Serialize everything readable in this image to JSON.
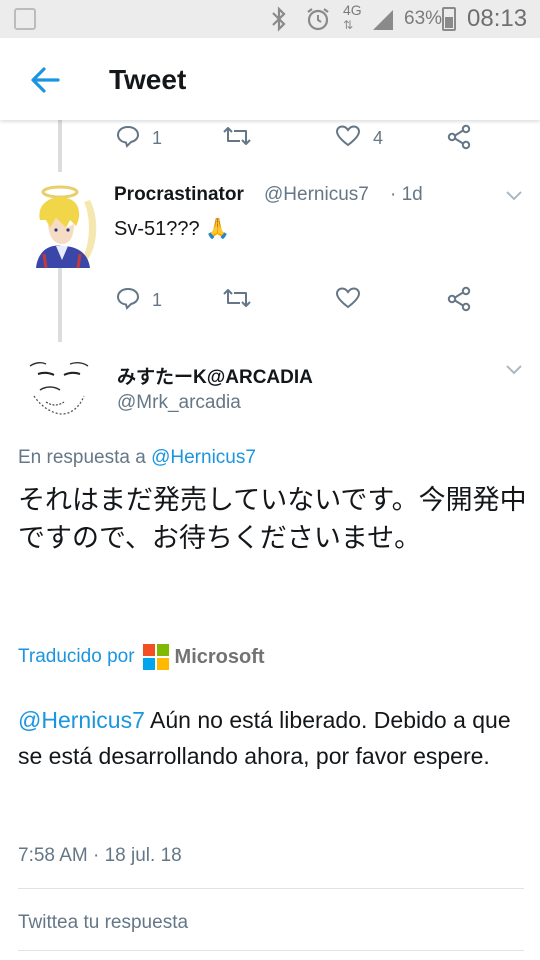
{
  "status_bar": {
    "battery": "63%",
    "battery_level": 0.63,
    "time": "08:13",
    "network": "4G",
    "icons": [
      "notification-icon",
      "bluetooth-icon",
      "alarm-icon",
      "signal-icon",
      "battery-icon"
    ]
  },
  "header": {
    "title": "Tweet",
    "back_icon": "back-arrow-icon"
  },
  "colors": {
    "accent": "#1b95e0",
    "text": "#14171a",
    "secondary": "#657786"
  },
  "prev_tweet_actions": {
    "reply_count": "1",
    "like_count": "4"
  },
  "tweet_procrastinator": {
    "name": "Procrastinator",
    "handle": "@Hernicus7",
    "age": "· 1d",
    "text": "Sv-51??? 🙏",
    "reply_count": "1"
  },
  "main_tweet": {
    "name": "みすたーK@ARCADIA",
    "handle": "@Mrk_arcadia",
    "reply_prefix": "En respuesta a",
    "reply_to": "@Hernicus7",
    "text": "それはまだ発売していないです。今開発中ですので、お待ちくださいませ。",
    "translated_by": "Traducido por",
    "translator": "Microsoft",
    "translation_mention": "@Hernicus7",
    "translation_text": " Aún no está liberado. Debido a que se está desarrollando ahora, por favor espere.",
    "timestamp": "7:58 AM · 18 jul. 18"
  },
  "reply_box": {
    "placeholder": "Twittea tu respuesta"
  }
}
